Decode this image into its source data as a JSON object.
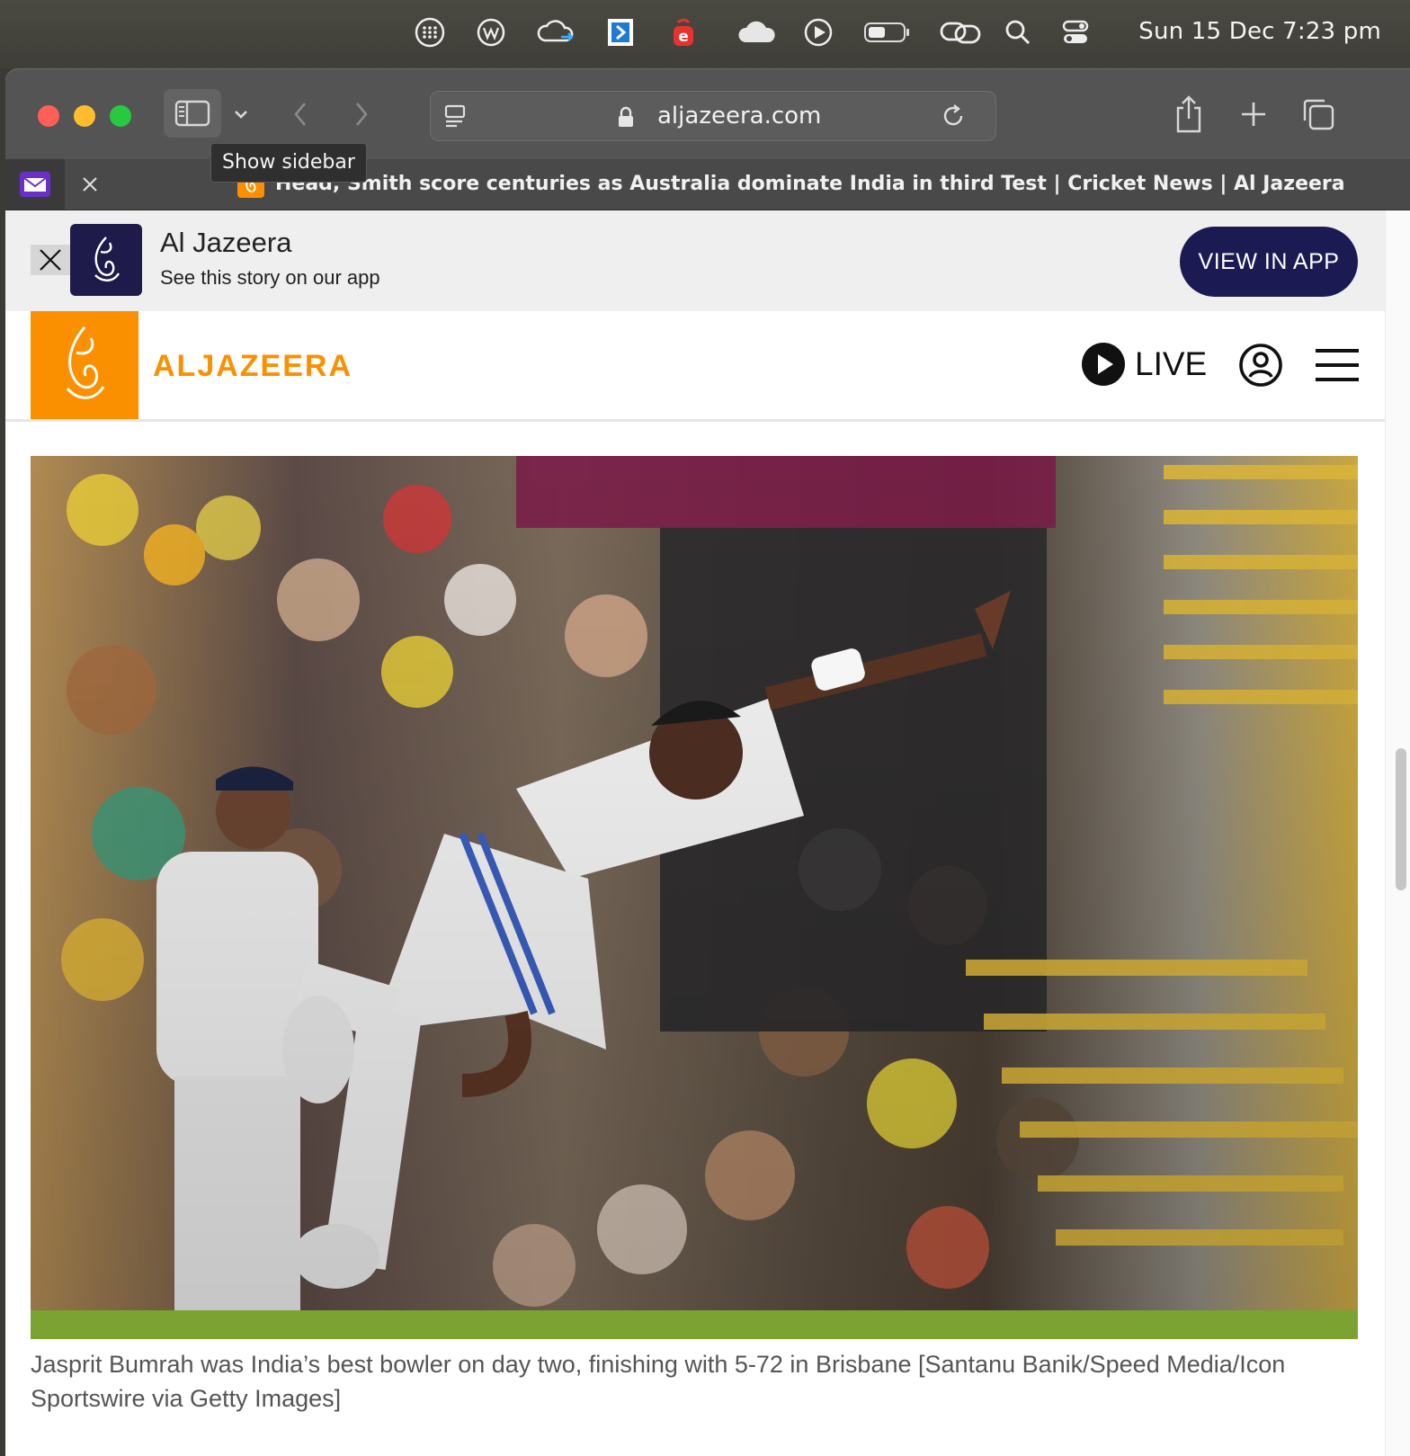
{
  "menubar": {
    "clock": "Sun 15 Dec  7:23 pm",
    "icons": [
      "grid-dots-icon",
      "wordpress-icon",
      "cloud-sync-icon",
      "dictionary-icon",
      "elsevier-icon",
      "icloud-icon",
      "play-circle-icon",
      "battery-icon",
      "link-icon",
      "spotlight-search-icon",
      "control-center-icon"
    ]
  },
  "browser": {
    "url": "aljazeera.com",
    "tooltip": "Show sidebar",
    "tab_title": "Head, Smith score centuries as Australia dominate India in third Test | Cricket News | Al Jazeera",
    "traffic_colors": [
      "#ff5f57",
      "#febc2e",
      "#28c840"
    ]
  },
  "app_banner": {
    "title": "Al Jazeera",
    "subtitle": "See this story on our app",
    "button": "VIEW IN APP",
    "button_color": "#1c1a52"
  },
  "site_header": {
    "logo_text": "ALJAZEERA",
    "brand_color": "#fa9000",
    "live_label": "LIVE"
  },
  "article": {
    "caption": "Jasprit Bumrah was India’s best bowler on day two, finishing with 5-72 in Brisbane [Santanu Banik/Speed Media/Icon Sportswire via Getty Images]"
  }
}
